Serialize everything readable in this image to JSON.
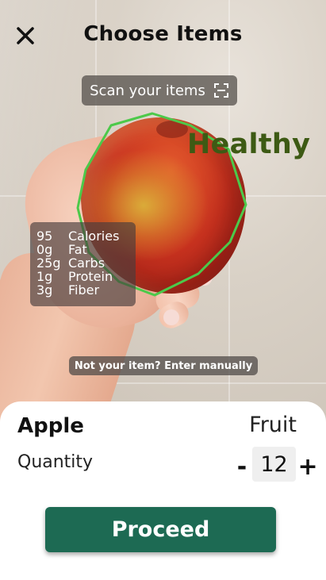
{
  "header": {
    "title": "Choose Items",
    "close_icon": "close-icon"
  },
  "scan": {
    "label": "Scan your items",
    "icon": "scan-frame-icon"
  },
  "detection": {
    "health_tag": "Healthy",
    "health_color": "#3d5a14",
    "outline_color": "#4cc94a",
    "nutrition": [
      {
        "value": "95",
        "label": "Calories"
      },
      {
        "value": "0g",
        "label": "Fat"
      },
      {
        "value": "25g",
        "label": "Carbs"
      },
      {
        "value": "1g",
        "label": "Protein"
      },
      {
        "value": "3g",
        "label": "Fiber"
      }
    ]
  },
  "manual_entry": {
    "label": "Not your item? Enter manually"
  },
  "item": {
    "name": "Apple",
    "category": "Fruit",
    "quantity_label": "Quantity",
    "quantity": "12",
    "minus": "-",
    "plus": "+"
  },
  "actions": {
    "proceed_label": "Proceed",
    "proceed_color": "#1d6a53"
  }
}
